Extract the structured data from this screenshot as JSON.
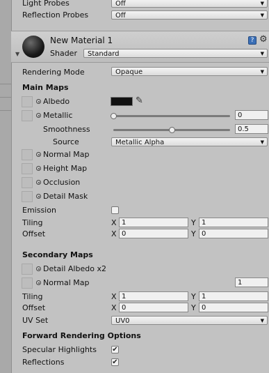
{
  "top": {
    "light_probes_label": "Light Probes",
    "light_probes_value": "Off",
    "reflection_probes_label": "Reflection Probes",
    "reflection_probes_value": "Off"
  },
  "material": {
    "name": "New Material 1",
    "shader_label": "Shader",
    "shader_value": "Standard",
    "help_icon": "book-help-icon",
    "settings_icon": "gear-icon"
  },
  "rendering": {
    "label": "Rendering Mode",
    "value": "Opaque"
  },
  "main_maps": {
    "heading": "Main Maps",
    "albedo_label": "Albedo",
    "albedo_color": "#111111",
    "metallic_label": "Metallic",
    "metallic_value": "0",
    "metallic_level": 0,
    "smoothness_label": "Smoothness",
    "smoothness_value": "0.5",
    "smoothness_level": 0.5,
    "source_label": "Source",
    "source_value": "Metallic Alpha",
    "normal_map_label": "Normal Map",
    "height_map_label": "Height Map",
    "occlusion_label": "Occlusion",
    "detail_mask_label": "Detail Mask",
    "emission_label": "Emission",
    "tiling_label": "Tiling",
    "tiling_x": "1",
    "tiling_y": "1",
    "offset_label": "Offset",
    "offset_x": "0",
    "offset_y": "0",
    "x_label": "X",
    "y_label": "Y"
  },
  "secondary_maps": {
    "heading": "Secondary Maps",
    "detail_albedo_label": "Detail Albedo x2",
    "normal_map_label": "Normal Map",
    "normal_map_value": "1",
    "tiling_label": "Tiling",
    "tiling_x": "1",
    "tiling_y": "1",
    "offset_label": "Offset",
    "offset_x": "0",
    "offset_y": "0",
    "uv_set_label": "UV Set",
    "uv_set_value": "UV0",
    "x_label": "X",
    "y_label": "Y"
  },
  "forward": {
    "heading": "Forward Rendering Options",
    "specular_label": "Specular Highlights",
    "specular_checked": true,
    "reflections_label": "Reflections",
    "reflections_checked": true,
    "check_glyph": "✔"
  },
  "dropdown_arrow": "▼"
}
